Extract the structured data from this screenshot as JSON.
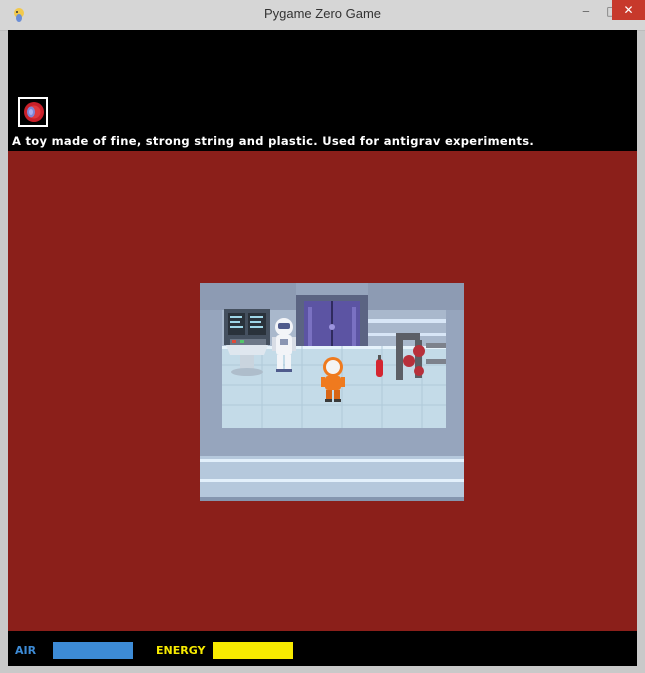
{
  "window": {
    "title": "Pygame Zero Game",
    "minimize_glyph": "‒",
    "maximize_glyph": "□",
    "close_glyph": "✕"
  },
  "hud": {
    "item_description": "A toy made of fine, strong string and plastic. Used for antigrav experiments.",
    "selected_item_icon": "yoyo-icon",
    "air_label": "AIR",
    "energy_label": "ENERGY",
    "air_level": 1.0,
    "energy_level": 1.0
  },
  "colors": {
    "play_background": "#8b1f1a",
    "air": "#3d8bd6",
    "energy": "#f7ea00",
    "hud_background": "#000000"
  }
}
